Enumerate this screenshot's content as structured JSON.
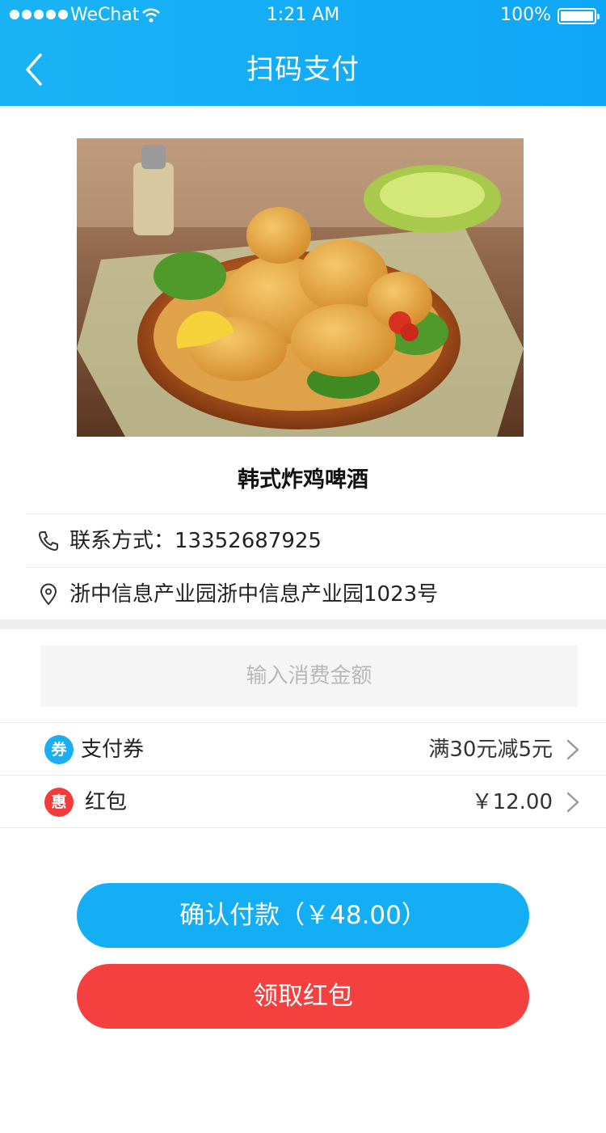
{
  "status_bar": {
    "carrier": "WeChat",
    "time": "1:21 AM",
    "battery": "100%"
  },
  "header": {
    "title": "扫码支付"
  },
  "shop": {
    "name": "韩式炸鸡啤酒",
    "contact": "联系方式：13352687925",
    "address": "浙中信息产业园浙中信息产业园1023号"
  },
  "amount": {
    "placeholder": "输入消费金额",
    "value": ""
  },
  "options": [
    {
      "badge": "券",
      "label": "支付券",
      "value": "满30元减5元",
      "badge_color": "#1aaef2"
    },
    {
      "badge": "惠",
      "label": "红包",
      "value": "￥12.00",
      "badge_color": "#f23b3b"
    }
  ],
  "buttons": {
    "confirm": "确认付款（￥48.00）",
    "red_packet": "领取红包"
  },
  "colors": {
    "header": "#14aef5",
    "confirm_button": "#14aef5",
    "red_button": "#f54040"
  }
}
